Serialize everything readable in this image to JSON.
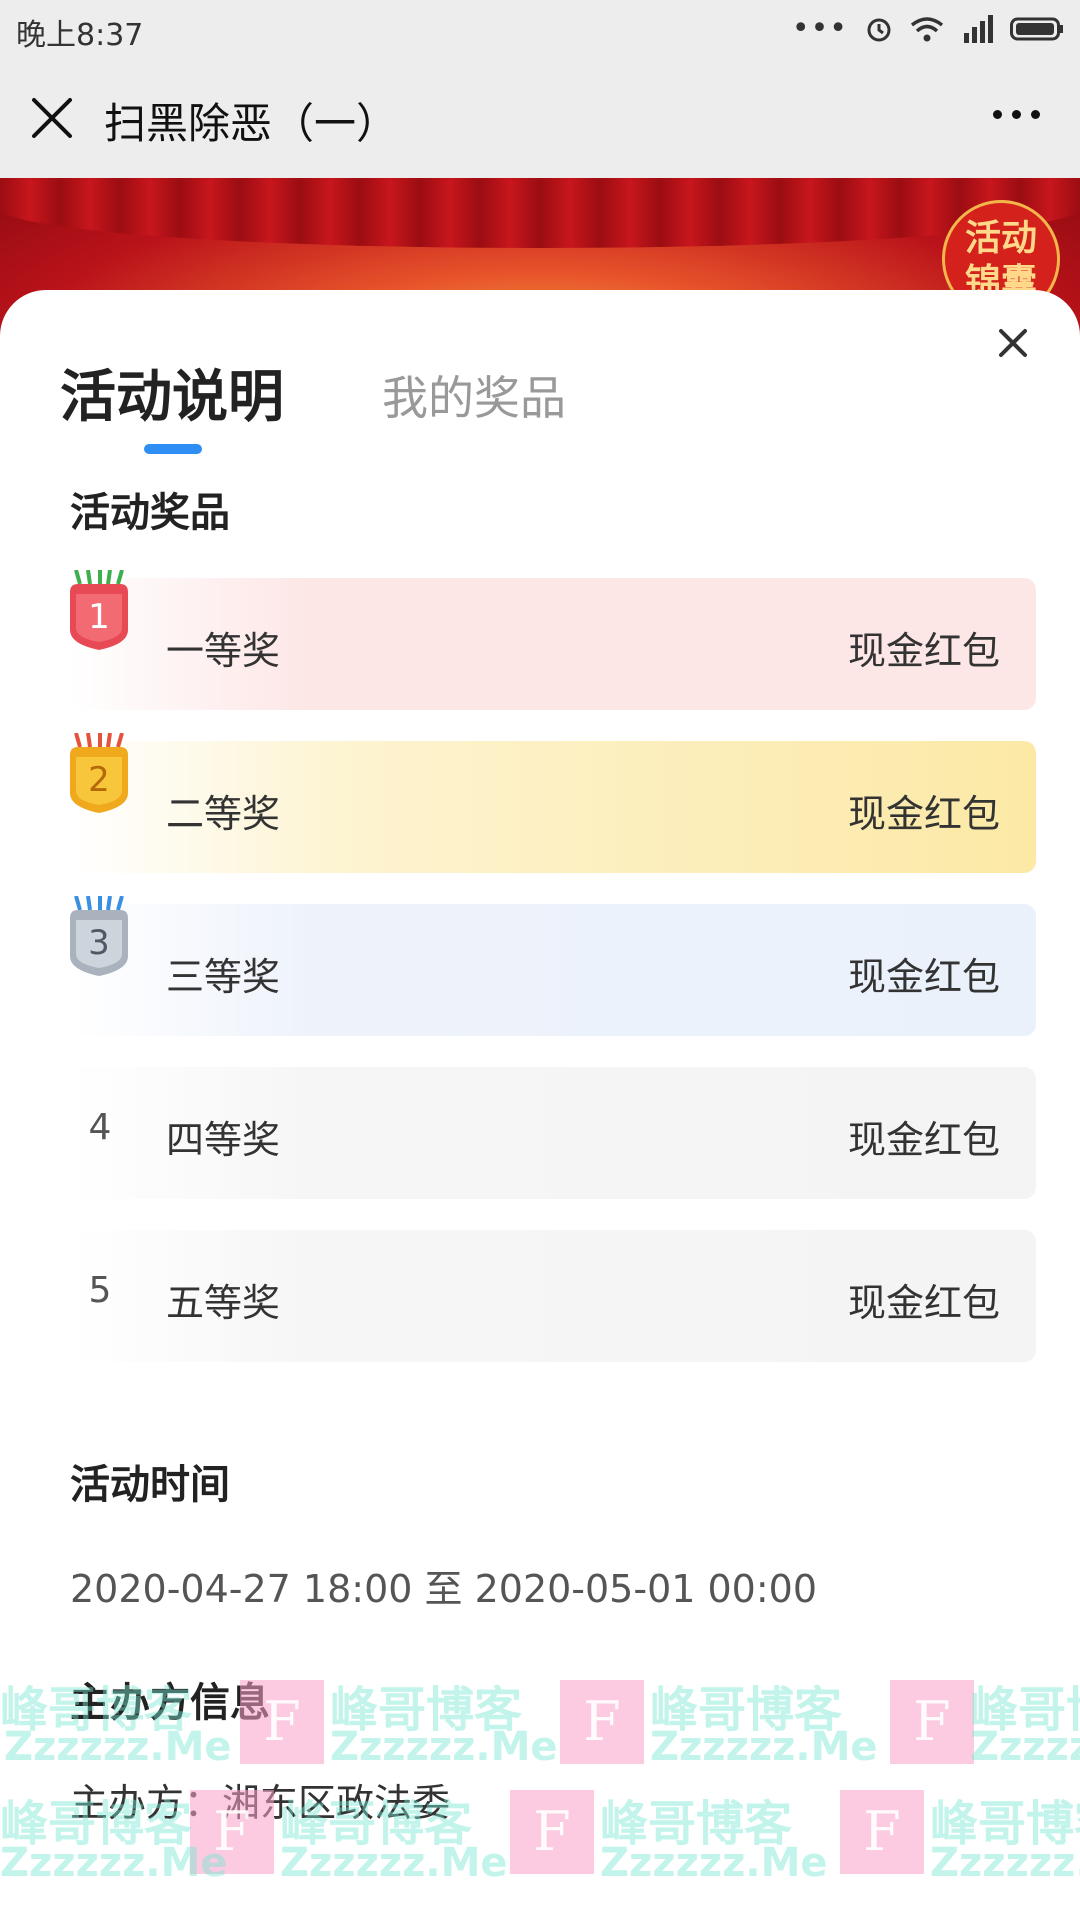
{
  "status_bar": {
    "time": "晚上8:37",
    "more_dots": "•••"
  },
  "title_bar": {
    "title": "扫黑除恶（一）"
  },
  "banner": {
    "badge_text": "活动\n锦囊"
  },
  "tabs": [
    {
      "label": "活动说明",
      "active": true
    },
    {
      "label": "我的奖品",
      "active": false
    }
  ],
  "prizes_section": {
    "title": "活动奖品",
    "items": [
      {
        "rank": "1",
        "name": "一等奖",
        "reward": "现金红包",
        "medal": "gold-red"
      },
      {
        "rank": "2",
        "name": "二等奖",
        "reward": "现金红包",
        "medal": "gold"
      },
      {
        "rank": "3",
        "name": "三等奖",
        "reward": "现金红包",
        "medal": "silver"
      },
      {
        "rank": "4",
        "name": "四等奖",
        "reward": "现金红包",
        "medal": ""
      },
      {
        "rank": "5",
        "name": "五等奖",
        "reward": "现金红包",
        "medal": ""
      }
    ]
  },
  "time_section": {
    "title": "活动时间",
    "value": "2020-04-27 18:00 至 2020-05-01 00:00"
  },
  "organizer_section": {
    "title": "主办方信息",
    "value": "主办方：湘东区政法委"
  },
  "watermark": {
    "brand": "峰哥博客",
    "url": "Zzzzzz.Me",
    "letter": "F"
  },
  "colors": {
    "accent": "#2f8ef4",
    "banner_red": "#b9121a",
    "row1_bg": "#fde6e6",
    "row2_bg": "#fce9a6",
    "row3_bg": "#eaf1fb",
    "row_default_bg": "#f4f4f4"
  }
}
